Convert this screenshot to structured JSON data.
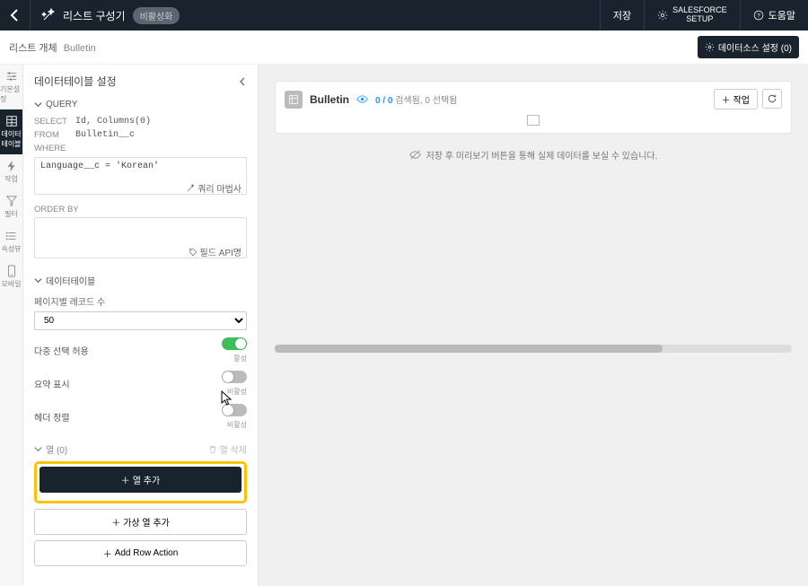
{
  "topbar": {
    "title": "리스트 구성기",
    "badge": "비활성화",
    "save": "저장",
    "setup_l1": "SALESFORCE",
    "setup_l2": "SETUP",
    "help": "도움말"
  },
  "subbar": {
    "crumb_label": "리스트 개체",
    "crumb_obj": "Bulletin",
    "ds_btn": "데이터소스 설정 (0)"
  },
  "rail": {
    "basic": "기본설정",
    "table": "데이터\n테이블",
    "action": "작업",
    "filter": "필터",
    "summary": "속성뷰",
    "mobile": "모바일"
  },
  "panel": {
    "title": "데이터테이블 설정",
    "query_header": "QUERY",
    "select_k": "SELECT",
    "select_v": "Id, Columns(0)",
    "from_k": "FROM",
    "from_v": "Bulletin__c",
    "where_k": "WHERE",
    "where_v": "Language__c = 'Korean'",
    "wizard": "쿼리 마법사",
    "orderby_k": "ORDER BY",
    "field_api": "필드 API명",
    "datatable_header": "데이터테이블",
    "page_records_label": "페이지별 레코드 수",
    "page_records_value": "50",
    "multi_select": "다중 선택 허용",
    "on_text": "활성",
    "summary_show": "요약 표시",
    "off_text": "비활성",
    "header_align": "헤더 정렬",
    "cols_header": "열 (0)",
    "cols_delete": "열 삭제",
    "add_col": "열 추가",
    "add_virtual": "가상 열 추가",
    "add_row_action": "Add Row Action"
  },
  "canvas": {
    "object": "Bulletin",
    "count": "0 / 0",
    "searched": "검색됨,",
    "selected": "0 선택됨",
    "action_label": "작업",
    "notice": "저장 후 미리보기 버튼을 통해 실제 데이터를 보실 수 있습니다."
  }
}
